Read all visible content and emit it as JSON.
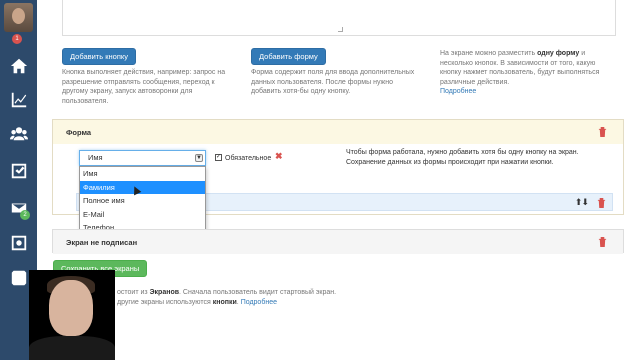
{
  "sidebar": {
    "badges": {
      "avatar": "1",
      "messages": "2"
    },
    "icons": [
      "home-icon",
      "chart-icon",
      "users-icon",
      "checklist-icon",
      "mail-icon",
      "safe-icon",
      "logo-icon"
    ]
  },
  "actions": {
    "add_button_label": "Добавить кнопку",
    "add_button_desc": "Кнопка выполняет действия, например: запрос на разрешение отправлять сообщения, переход к другому экрану, запуск автоворонки для пользователя.",
    "add_form_label": "Добавить форму",
    "add_form_desc": "Форма содержит поля для ввода дополнительных данных пользователя. После формы нужно добавить хотя-бы одну кнопку.",
    "info_text_1": "На экране можно разместить",
    "info_bold_1": "одну форму",
    "info_text_2": "и несколько кнопок. В зависимости от того, какую кнопку нажмет пользователь, будут выполняться различные действия.",
    "info_link": "Подробнее"
  },
  "form_panel": {
    "title": "Форма",
    "select_value": "Имя",
    "options": [
      "Имя",
      "Фамилия",
      "Полное имя",
      "E-Mail",
      "Телефон"
    ],
    "selected_index": 1,
    "required_label": "Обязательное",
    "hint_1": "Чтобы форма работала, нужно добавить хотя бы одну кнопку на экран.",
    "hint_2": "Сохранение данных из формы происходит при нажатии кнопки."
  },
  "screen_panel": {
    "title": "Экран не подписан"
  },
  "save_label": "Сохранить все экраны",
  "footer": {
    "line1_a": "остоит из",
    "line1_b": "Экранов",
    "line1_c": ". Сначала пользователь видит стартовый экран.",
    "line2_a": "другие экраны используются",
    "line2_b": "кнопки",
    "line2_c": ".",
    "link": "Подробнее"
  },
  "colors": {
    "sidebar": "#2d4a6b",
    "primary": "#337ab7",
    "success": "#5cb85c",
    "danger": "#d9534f",
    "panel_head": "#fcf8e3"
  }
}
